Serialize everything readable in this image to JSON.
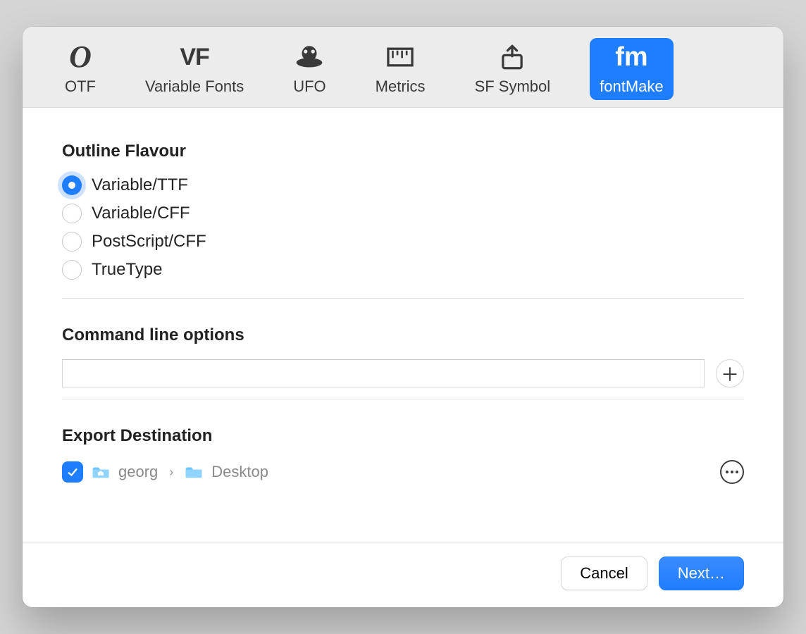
{
  "toolbar": {
    "tabs": [
      {
        "label": "OTF"
      },
      {
        "label": "Variable Fonts"
      },
      {
        "label": "UFO"
      },
      {
        "label": "Metrics"
      },
      {
        "label": "SF Symbol"
      },
      {
        "label": "fontMake"
      }
    ],
    "active_index": 5
  },
  "sections": {
    "outline_flavour": {
      "title": "Outline Flavour",
      "options": [
        "Variable/TTF",
        "Variable/CFF",
        "PostScript/CFF",
        "TrueType"
      ],
      "selected_index": 0
    },
    "command_line": {
      "title": "Command line options",
      "value": ""
    },
    "export_destination": {
      "title": "Export Destination",
      "checked": true,
      "path_segments": [
        "georg",
        "Desktop"
      ]
    }
  },
  "footer": {
    "cancel_label": "Cancel",
    "next_label": "Next…"
  }
}
